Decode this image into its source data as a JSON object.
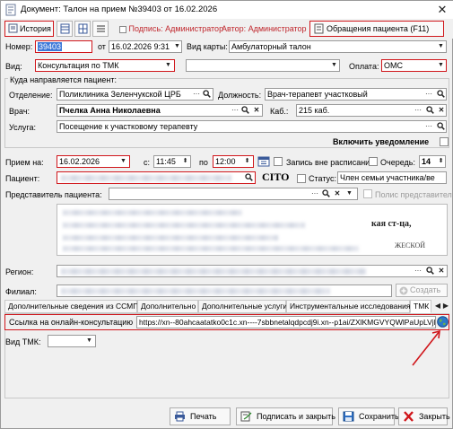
{
  "window": {
    "title": "Документ: Талон на прием №39403 от 16.02.2026",
    "close_label": "✕"
  },
  "toolbar": {
    "history_label": "История",
    "signature_label": "Подпись: Администратор",
    "author_label": "Автор: Администратор",
    "appeals_label": "Обращения пациента (F11)"
  },
  "form": {
    "number_label": "Номер:",
    "number_value": "39403",
    "from_label": "от",
    "date_value": "16.02.2026 9:31",
    "card_type_label": "Вид карты:",
    "card_type_value": "Амбулаторный талон",
    "kind_label": "Вид:",
    "kind_value": "Консультация по ТМК",
    "kind2_value": "",
    "payment_label": "Оплата:",
    "payment_value": "ОМС",
    "direction_group": "Куда направляется пациент:",
    "department_label": "Отделение:",
    "department_value": "Поликлиника Зеленчукской ЦРБ",
    "position_label": "Должность:",
    "position_value": "Врач-терапевт участковый",
    "doctor_label": "Врач:",
    "doctor_value": "Пчелка Анна Николаевна",
    "cabinet_label": "Каб.:",
    "cabinet_value": "215 каб.",
    "service_label": "Услуга:",
    "service_value": "Посещение к участковому терапевту",
    "notify_label": "Включить уведомление",
    "appointment_label": "Прием на:",
    "appointment_date": "16.02.2026",
    "time_from_label": "с:",
    "time_from": "11:45",
    "time_to_label": "по",
    "time_to": "12:00",
    "out_of_schedule_label": "Запись вне расписания",
    "queue_label": "Очередь:",
    "queue_value": "14",
    "patient_label": "Пациент:",
    "cito_label": "CITO",
    "status_label": "Статус:",
    "status_value": "Член семьи участника/ве",
    "representative_label": "Представитель пациента:",
    "representative_policy_label": "Полис представителя",
    "region_label": "Регион:",
    "branch_label": "Филиал:",
    "create_label": "Создать",
    "blurred_text_1": "кая ст-ца,",
    "blurred_text_2": "ЖЕСКОЙ"
  },
  "tabs": [
    {
      "label": "Дополнительные сведения из ССМП"
    },
    {
      "label": "Дополнительно"
    },
    {
      "label": "Дополнительные услуги"
    },
    {
      "label": "Инструментальные исследования"
    },
    {
      "label": "ТМК"
    }
  ],
  "tmk": {
    "link_label": "Ссылка на онлайн-консультацию",
    "link_value": "https://xn--80ahcaatatko0c1c.xn----7sbbnetalqdpcdj9i.xn--p1ai/ZXlKMGVYQWlPaUpLVjFRaU",
    "tmk_kind_label": "Вид ТМК:",
    "tmk_kind_value": ""
  },
  "footer": {
    "print_label": "Печать",
    "sign_close_label": "Подписать и закрыть",
    "save_label": "Сохранить",
    "close_label": "Закрыть"
  },
  "colors": {
    "required_border": "#d0161b",
    "selection": "#3c78d8",
    "annotation_arrow": "#d0161b"
  },
  "icons": [
    "document-icon",
    "history-icon",
    "table-icon",
    "grid-icon",
    "list-icon",
    "appeals-icon",
    "ellipsis-icon",
    "search-icon",
    "clear-icon",
    "calendar-icon",
    "dropdown-icon",
    "globe-icon",
    "printer-icon",
    "sign-icon",
    "save-icon",
    "close-icon"
  ]
}
